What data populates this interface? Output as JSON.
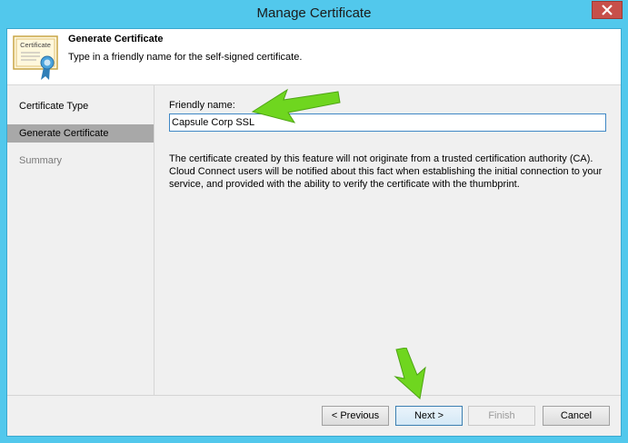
{
  "window": {
    "title": "Manage Certificate",
    "close_icon": "close-icon"
  },
  "header": {
    "icon_label": "Certificate",
    "title": "Generate Certificate",
    "description": "Type in a friendly name for the self-signed certificate."
  },
  "nav": {
    "items": [
      {
        "label": "Certificate Type",
        "state": "normal"
      },
      {
        "label": "Generate Certificate",
        "state": "active"
      },
      {
        "label": "Summary",
        "state": "disabled"
      }
    ]
  },
  "form": {
    "friendly_name_label": "Friendly name:",
    "friendly_name_value": "Capsule Corp SSL",
    "info_text": "The certificate created by this feature will not originate from a trusted certification authority (CA). Cloud Connect users will be notified about this fact when establishing the initial connection to your service, and provided with the ability to verify the certificate with the thumbprint."
  },
  "footer": {
    "previous_label": "< Previous",
    "next_label": "Next >",
    "finish_label": "Finish",
    "cancel_label": "Cancel"
  },
  "colors": {
    "title_bar": "#52c8ec",
    "close_button": "#c7504a",
    "active_nav": "#a8a8a8",
    "annotation_arrow": "#6fd61f"
  },
  "annotations": [
    "green-arrow-icon",
    "green-arrow-icon"
  ]
}
